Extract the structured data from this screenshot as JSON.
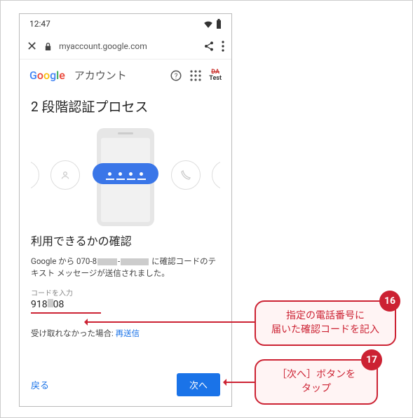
{
  "status": {
    "time": "12:47"
  },
  "addressbar": {
    "url": "myaccount.google.com"
  },
  "header": {
    "logo": {
      "g": "G",
      "o1": "o",
      "o2": "o",
      "g2": "g",
      "l": "l",
      "e": "e"
    },
    "account_label": "アカウント",
    "badge_line1": "DA",
    "badge_line2": "Test"
  },
  "page": {
    "title": "2 段階認証プロセス",
    "subtitle": "利用できるかの確認",
    "desc_prefix": "Google から 070-8",
    "desc_mid": "-",
    "desc_suffix": " に確認コードのテキスト メッセージが送信されました。",
    "field_label": "コードを入力",
    "code_part1": "918",
    "code_part2": "08",
    "resend_prefix": "受け取れなかった場合: ",
    "resend_link": "再送信",
    "back": "戻る",
    "next": "次へ"
  },
  "callouts": {
    "c16_num": "16",
    "c16_text": "指定の電話番号に\n届いた確認コードを記入",
    "c17_num": "17",
    "c17_text": "［次へ］ボタンを\nタップ"
  }
}
